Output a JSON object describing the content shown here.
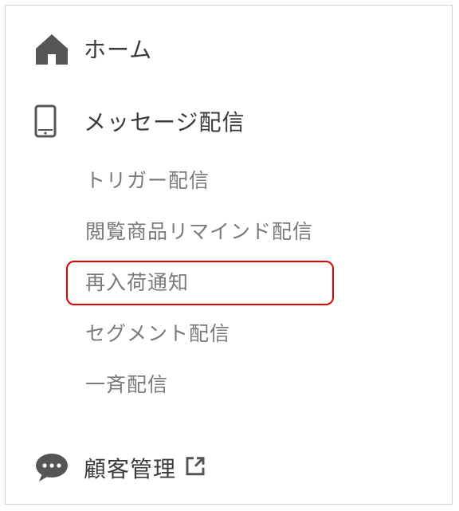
{
  "nav": {
    "home": {
      "label": "ホーム",
      "icon": "home-icon"
    },
    "messages": {
      "label": "メッセージ配信",
      "icon": "smartphone-icon",
      "sub_items": [
        "トリガー配信",
        "閲覧商品リマインド配信",
        "再入荷通知",
        "セグメント配信",
        "一斉配信"
      ]
    },
    "customers": {
      "label": "顧客管理",
      "icon": "chat-bubble-icon",
      "trailing_icon": "external-link-icon"
    }
  },
  "highlight": {
    "target": "再入荷通知",
    "color": "#e10000"
  },
  "colors": {
    "icon": "#555555",
    "label": "#3a3a3a",
    "sub_label": "#7a7a7a",
    "border": "#cfcfcf"
  }
}
